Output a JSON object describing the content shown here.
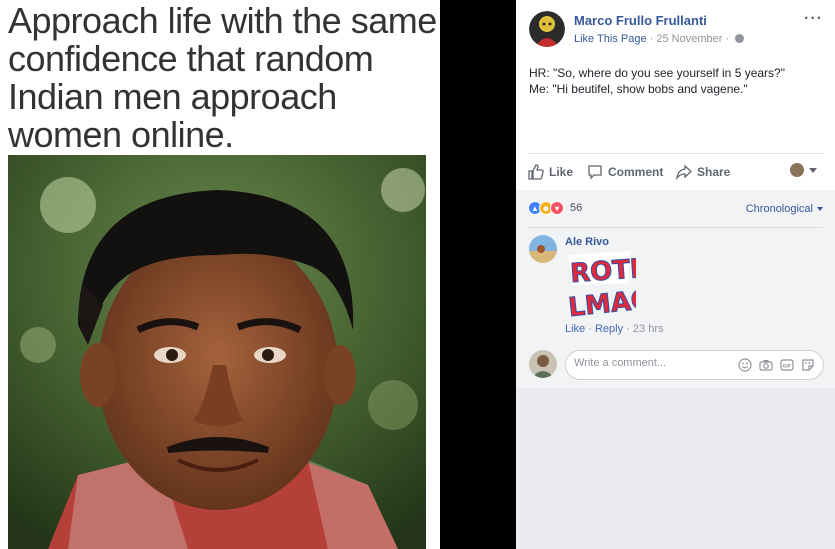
{
  "meme": {
    "caption": "Approach life with the same\nconfidence that random\nIndian men approach\nwomen online."
  },
  "post": {
    "author": "Marco Frullo Frullanti",
    "page_link": "Like This Page",
    "separator": "·",
    "date": "25 November",
    "more_label": "···",
    "text_line1": "HR: \"So, where do you see yourself in 5 years?\"",
    "text_line2": "Me: \"Hi beutifel, show bobs and vagene.\""
  },
  "actions": {
    "like": "Like",
    "comment": "Comment",
    "share": "Share"
  },
  "reactions": {
    "count": "56",
    "sort_label": "Chronological"
  },
  "comment": {
    "author": "Ale Rivo",
    "sticker_line1": "ROTF",
    "sticker_line2": "LMAO",
    "like": "Like",
    "reply": "Reply",
    "dot": "·",
    "time": "23 hrs"
  },
  "composer": {
    "placeholder": "Write a comment..."
  },
  "colors": {
    "link": "#365899",
    "sticker_red": "#e2293c",
    "sticker_blue": "#2f4fa8"
  }
}
